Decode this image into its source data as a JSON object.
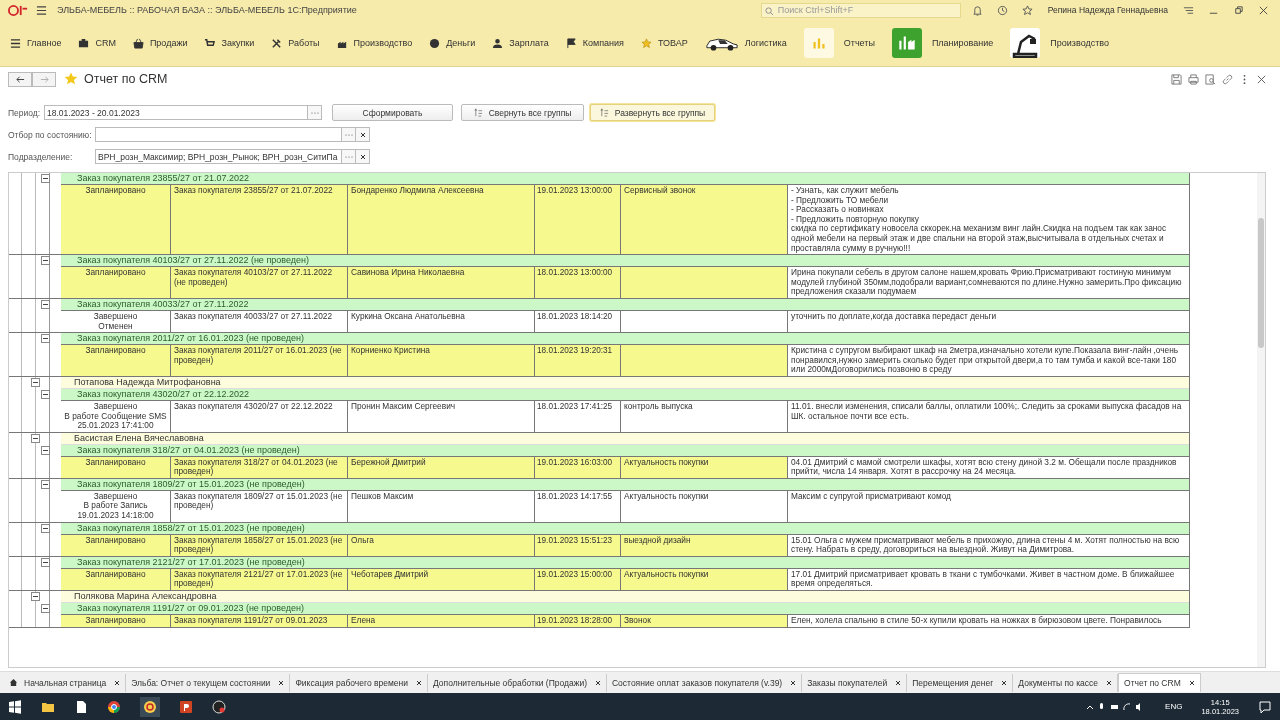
{
  "title_bar": {
    "app_title": "ЭЛЬБА-МЕБЕЛЬ :: РАБОЧАЯ БАЗА :: ЭЛЬБА-МЕБЕЛЬ 1С:Предприятие",
    "search_placeholder": "Поиск Ctrl+Shift+F",
    "user": "Репина Надежда Геннадьевна"
  },
  "sections": [
    {
      "label": "Главное"
    },
    {
      "label": "CRM"
    },
    {
      "label": "Продажи"
    },
    {
      "label": "Закупки"
    },
    {
      "label": "Работы"
    },
    {
      "label": "Производство"
    },
    {
      "label": "Деньги"
    },
    {
      "label": "Зарплата"
    },
    {
      "label": "Компания"
    },
    {
      "label": "ТОВАР"
    },
    {
      "label": "Логистика"
    },
    {
      "label": "Отчеты"
    },
    {
      "label": "Планирование"
    },
    {
      "label": "Производство"
    }
  ],
  "form": {
    "title": "Отчет по CRM",
    "period": {
      "label": "Период:",
      "value": "18.01.2023 - 20.01.2023"
    },
    "buttons": [
      {
        "label": "Сформировать",
        "selected": false
      },
      {
        "label": "Свернуть все группы",
        "selected": false
      },
      {
        "label": "Развернуть все группы",
        "selected": true
      }
    ],
    "state_filter": {
      "label": "Отбор по состоянию:"
    },
    "division": {
      "label": "Подразделение:",
      "value": "ВРН_розн_Максимир; ВРН_розн_Рынок; ВРН_розн_СитиПа"
    }
  },
  "report": {
    "groups": [
      {
        "children": [
          {
            "title": "Заказ покупателя 23855/27 от 21.07.2022",
            "expanded": true,
            "children": [
              {
                "highlighted": true,
                "status": "Запланировано",
                "order": "Заказ покупателя 23855/27 от 21.07.2022",
                "client": "Бондаренко Людмила Алексеевна",
                "datetime": "19.01.2023 13:00:00",
                "type": "Сервисный звонок",
                "note": "- Узнать, как служит мебель\n- Предложить ТО мебели\n- Рассказать о новинках\n- Предложить повторную покупку\nскидка по сертификату новосела сккорек.на механизм винг лайн.Скидка на подъем так как занос одной мебели на первый этаж и две спальни на второй этаж,высчитывала в отдельных счетах и проставляла сумму в ручную!!!"
              }
            ]
          },
          {
            "title": "Заказ покупателя 40103/27 от 27.11.2022 (не проведен)",
            "expanded": true,
            "children": [
              {
                "highlighted": true,
                "status": "Запланировано",
                "order": "Заказ покупателя 40103/27 от 27.11.2022 (не проведен)",
                "client": "Савинова Ирина Николаевна",
                "datetime": "18.01.2023 13:00:00",
                "note": "Ирина покупали себель в другом салоне нашем,кровать Фрию.Присматривают гостиную минимум модулей глубиной 350мм,подобрали вариант,сомневаются по длине.Нужно замерить.Про фиксацию предложения сказали подумаем"
              }
            ]
          },
          {
            "title": "Заказ покупателя 40033/27 от 27.11.2022",
            "expanded": true,
            "children": [
              {
                "highlighted": false,
                "status": "Завершено",
                "substatus": "Отменен",
                "order": "Заказ покупателя 40033/27 от 27.11.2022",
                "client": "Куркина Оксана Анатольевна",
                "datetime": "18.01.2023 18:14:20",
                "note": "уточнить по доплате,когда доставка передаст деньги"
              }
            ]
          },
          {
            "title": "Заказ покупателя 2011/27 от 16.01.2023 (не проведен)",
            "expanded": true,
            "children": [
              {
                "highlighted": true,
                "status": "Запланировано",
                "order": "Заказ покупателя 2011/27 от 16.01.2023 (не проведен)",
                "client": "Корниенко Кристина",
                "datetime": "18.01.2023 19:20:31",
                "note": "Кристина с супругом выбирают шкаф на 2метра,изначально хотели купе.Показала винг-лайн ,очень понравился,нужно замерить сколько будет при открытой двери,а то там тумба и какой все-таки 180 или 2000мДоговорились позвоню в среду"
              }
            ]
          }
        ]
      },
      {
        "name": "Потапова Надежда Митрофановна",
        "expanded": true,
        "children": [
          {
            "title": "Заказ покупателя 43020/27 от 22.12.2022",
            "expanded": true,
            "children": [
              {
                "highlighted": false,
                "status": "Завершено",
                "substatus": "В работе Сообщение SMS 25.01.2023 17:41:00",
                "order": "Заказ покупателя 43020/27 от 22.12.2022",
                "client": "Пронин Максим Сергеевич",
                "datetime": "18.01.2023 17:41:25",
                "type": "контроль выпуска",
                "note": "11.01. внесли изменения, списали баллы, оплатили 100%;. Следить за сроками выпуска фасадов на ШК. остальное почти все есть."
              }
            ]
          }
        ]
      },
      {
        "name": "Басистая Елена Вячеславовна",
        "expanded": true,
        "children": [
          {
            "title": "Заказ покупателя 318/27 от 04.01.2023 (не проведен)",
            "expanded": true,
            "children": [
              {
                "highlighted": true,
                "status": "Запланировано",
                "order": "Заказ покупателя 318/27 от 04.01.2023 (не проведен)",
                "client": "Бережной Дмитрий",
                "datetime": "19.01.2023 16:03:00",
                "type": "Актуальность покупки",
                "note": "04.01 Дмитрий с мамой смотрели шкафы, хотят всю стену диной 3.2 м. Обещали после праздников прийти, числа 14 января. Хотят в рассрочку на 24 месяца."
              }
            ]
          },
          {
            "title": "Заказ покупателя 1809/27 от 15.01.2023 (не проведен)",
            "expanded": true,
            "children": [
              {
                "highlighted": false,
                "status": "Завершено",
                "substatus": "В работе Запись 19.01.2023 14:18:00",
                "order": "Заказ покупателя 1809/27 от 15.01.2023 (не проведен)",
                "client": "Пешков Максим",
                "datetime": "18.01.2023 14:17:55",
                "type": "Актуальность покупки",
                "note": "Максим с супругой присматривают комод"
              }
            ]
          },
          {
            "title": "Заказ покупателя 1858/27 от 15.01.2023 (не проведен)",
            "expanded": true,
            "children": [
              {
                "highlighted": true,
                "status": "Запланировано",
                "order": "Заказ покупателя 1858/27 от 15.01.2023 (не проведен)",
                "client": "Ольга",
                "datetime": "19.01.2023 15:51:23",
                "type": "выездной дизайн",
                "note": "15.01 Ольга с мужем присматривают мебель в прихожую, длина стены 4 м. Хотят полностью на всю стену. Набрать в среду, договориться на выездной. Живут на Димитрова."
              }
            ]
          },
          {
            "title": "Заказ покупателя 2121/27 от 17.01.2023 (не проведен)",
            "expanded": true,
            "children": [
              {
                "highlighted": true,
                "status": "Запланировано",
                "order": "Заказ покупателя 2121/27 от 17.01.2023 (не проведен)",
                "client": "Чеботарев Дмитрий",
                "datetime": "19.01.2023 15:00:00",
                "type": "Актуальность покупки",
                "note": "17.01 Дмитрий присматривает кровать в ткани с тумбочками. Живет в частном доме. В ближайшее время определяться."
              }
            ]
          }
        ]
      },
      {
        "name": "Полякова Марина Александровна",
        "expanded": true,
        "children": [
          {
            "title": "Заказ покупателя 1191/27 от 09.01.2023 (не проведен)",
            "expanded": true,
            "children": [
              {
                "highlighted": true,
                "status": "Запланировано",
                "order": "Заказ покупателя 1191/27 от 09.01.2023",
                "client": "Елена",
                "datetime": "19.01.2023 18:28:00",
                "type": "Звонок",
                "note": "Елен, холела спальню в стиле 50-х купили кровать на ножках в бирюзовом цвете. Понравилось"
              }
            ]
          }
        ]
      }
    ]
  },
  "open_tabs": [
    {
      "label": "Начальная страница",
      "selected": false
    },
    {
      "label": "Эльба: Отчет о текущем состоянии",
      "selected": false
    },
    {
      "label": "Фиксация рабочего времени",
      "selected": false
    },
    {
      "label": "Дополнительные обработки (Продажи)",
      "selected": false
    },
    {
      "label": "Состояние оплат заказов покупателя (v.39)",
      "selected": false
    },
    {
      "label": "Заказы покупателей",
      "selected": false
    },
    {
      "label": "Перемещения денег",
      "selected": false
    },
    {
      "label": "Документы по кассе",
      "selected": false
    },
    {
      "label": "Отчет по CRM",
      "selected": true
    }
  ],
  "taskbar": {
    "language": "ENG",
    "time": "14:15",
    "date": "18.01.2023"
  }
}
